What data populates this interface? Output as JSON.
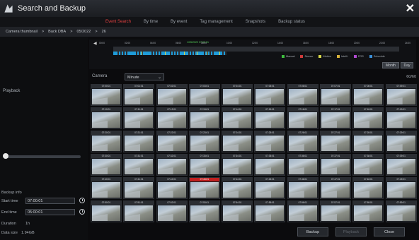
{
  "window": {
    "title": "Search and Backup",
    "close_glyph": "✕"
  },
  "tabs": [
    {
      "label": "Event Search",
      "active": true
    },
    {
      "label": "By time"
    },
    {
      "label": "By event"
    },
    {
      "label": "Tag management"
    },
    {
      "label": "Snapshots"
    },
    {
      "label": "Backup status"
    }
  ],
  "breadcrumb": [
    "Camera thumbnail",
    ">",
    "Back DBA",
    ">",
    "05/2022",
    ">",
    "26"
  ],
  "left": {
    "playback_label": "Playback",
    "backup_info_label": "Backup info",
    "start_label": "Start time",
    "start_value": "07:00:01",
    "end_label": "End time",
    "end_value": "05:00:01",
    "duration_label": "Duration",
    "duration_value": "1h",
    "size_label": "Data size",
    "size_value": "1.94GB"
  },
  "timeline": {
    "cursor_label": "1/05/2022 07:00:01",
    "ticks": [
      "00:00",
      "02:00",
      "04:00",
      "06:00",
      "08:00",
      "10:00",
      "12:00",
      "14:00",
      "16:00",
      "18:00",
      "20:00",
      "22:00",
      "24:00"
    ],
    "legend": [
      {
        "label": "Manual",
        "color": "#3fbf3f"
      },
      {
        "label": "Sensor",
        "color": "#d03a3a"
      },
      {
        "label": "Motion",
        "color": "#d8d84a"
      },
      {
        "label": "Intelli.",
        "color": "#d8b23a"
      },
      {
        "label": "POS",
        "color": "#b04ad0"
      },
      {
        "label": "Schedule",
        "color": "#3a8fd8"
      }
    ],
    "month_button": "Month",
    "day_button": "Day"
  },
  "filter": {
    "camera_label": "Camera",
    "select_value": "Minute",
    "count": "60/60"
  },
  "thumbnails": [
    "07:00:01",
    "07:01:01",
    "07:02:01",
    "07:03:01",
    "07:04:01",
    "07:05:01",
    "07:06:01",
    "07:07:01",
    "07:08:01",
    "07:09:01",
    "07:10:01",
    "07:11:01",
    "07:12:01",
    "07:13:01",
    "07:14:01",
    "07:15:01",
    "07:16:01",
    "07:17:01",
    "07:18:01",
    "07:19:01",
    "07:20:01",
    "07:21:01",
    "07:22:01",
    "07:23:01",
    "07:24:01",
    "07:25:01",
    "07:26:01",
    "07:27:01",
    "07:28:01",
    "07:29:01",
    "07:30:01",
    "07:31:01",
    "07:32:01",
    "07:33:01",
    "07:34:01",
    "07:35:01",
    "07:36:01",
    "07:37:01",
    "07:38:01",
    "07:39:01",
    "07:40:01",
    "07:41:01",
    "07:42:01",
    "07:43:01",
    "07:44:01",
    "07:45:01",
    "07:46:01",
    "07:47:01",
    "07:48:01",
    "07:49:01",
    "07:50:01",
    "07:51:01",
    "07:52:01",
    "07:53:01",
    "07:54:01",
    "07:55:01",
    "07:56:01",
    "07:57:01",
    "07:58:01",
    "07:59:01"
  ],
  "selected_index": 43,
  "buttons": {
    "backup": "Backup",
    "playback": "Playback",
    "close": "Close"
  },
  "colors": {
    "accent": "#e04040",
    "timeline_bar": "#1e9bd8"
  }
}
